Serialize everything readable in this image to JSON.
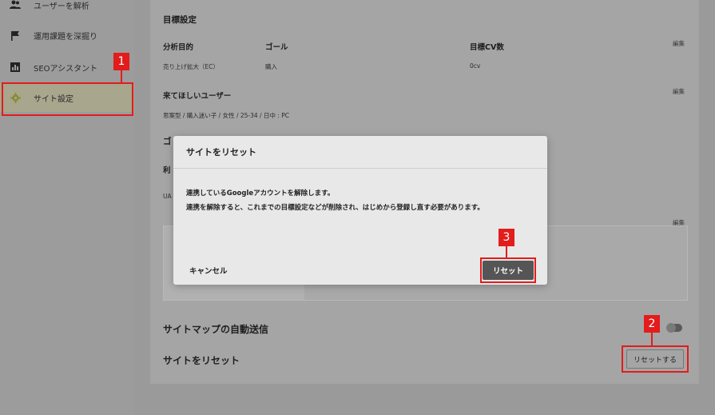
{
  "sidebar": {
    "items": [
      {
        "label": "ユーザーを解析",
        "icon": "users-icon"
      },
      {
        "label": "運用課題を深掘り",
        "icon": "flag-icon"
      },
      {
        "label": "SEOアシスタント",
        "icon": "bar-chart-icon"
      },
      {
        "label": "サイト設定",
        "icon": "gear-icon",
        "active": true
      }
    ]
  },
  "goals": {
    "heading": "目標設定",
    "col_purpose": "分析目的",
    "col_goal": "ゴール",
    "col_cv": "目標CV数",
    "edit": "編集",
    "purpose_value": "売り上げ拡大（EC）",
    "goal_value": "購入",
    "cv_value": "0cv"
  },
  "users": {
    "heading": "来てほしいユーザー",
    "edit": "編集",
    "value": "思案型 / 購入迷い子 / 女性 / 25-34 / 日中 : PC"
  },
  "partial": {
    "heading_fragment": "ゴ",
    "label_fragment": "利",
    "value_fragment": "UA",
    "edit": "編集"
  },
  "sitemap": {
    "label": "サイトマップの自動送信"
  },
  "reset_row": {
    "label": "サイトをリセット",
    "button": "リセットする"
  },
  "modal": {
    "title": "サイトをリセット",
    "line1": "連携しているGoogleアカウントを解除します。",
    "line2": "連携を解除すると、これまでの目標設定などが削除され、はじめから登録し直す必要があります。",
    "cancel": "キャンセル",
    "confirm": "リセット"
  },
  "annotations": {
    "n1": "1",
    "n2": "2",
    "n3": "3"
  },
  "colors": {
    "highlight": "#e31c1c",
    "active_item": "#a8a68c",
    "primary_button": "#555555"
  }
}
